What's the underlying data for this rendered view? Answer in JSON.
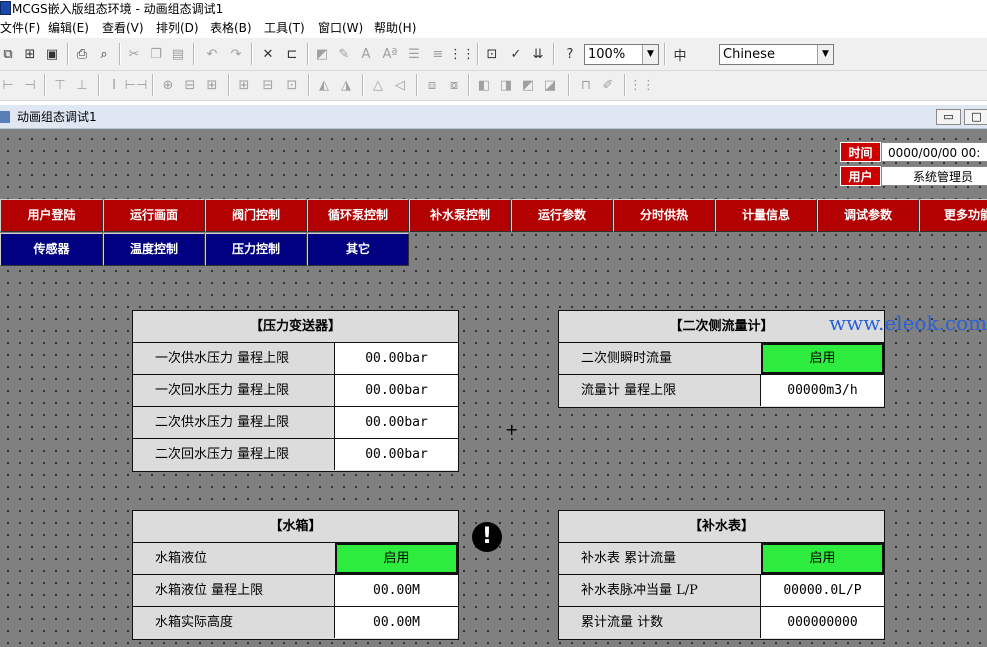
{
  "app": {
    "title": "MCGS嵌入版组态环境 - 动画组态调试1",
    "menu": [
      "文件(F)",
      "编辑(E)",
      "查看(V)",
      "排列(D)",
      "表格(B)",
      "工具(T)",
      "窗口(W)",
      "帮助(H)"
    ]
  },
  "toolbar": {
    "zoom": "100%",
    "language": "Chinese"
  },
  "window": {
    "title": "动画组态调试1",
    "minimize": "▭",
    "maximize": "□"
  },
  "info": {
    "time_label": "时间",
    "time_value": "0000/00/00 00:",
    "user_label": "用户",
    "user_value": "系统管理员"
  },
  "nav": {
    "row1": [
      "用户登陆",
      "运行画面",
      "阀门控制",
      "循环泵控制",
      "补水泵控制",
      "运行参数",
      "分时供热",
      "计量信息",
      "调试参数",
      "更多功能"
    ],
    "row2": [
      "传感器",
      "温度控制",
      "压力控制",
      "其它"
    ]
  },
  "panels": {
    "pressure": {
      "title": "【压力变送器】",
      "rows": [
        {
          "label": "一次供水压力 量程上限",
          "value": "00.00bar"
        },
        {
          "label": "一次回水压力 量程上限",
          "value": "00.00bar"
        },
        {
          "label": "二次供水压力 量程上限",
          "value": "00.00bar"
        },
        {
          "label": "二次回水压力 量程上限",
          "value": "00.00bar"
        }
      ]
    },
    "flow": {
      "title": "【二次侧流量计】",
      "rows": [
        {
          "label": "二次侧瞬时流量",
          "value": "启用"
        },
        {
          "label": "流量计 量程上限",
          "value": "00000m3/h"
        }
      ]
    },
    "tank": {
      "title": "【水箱】",
      "rows": [
        {
          "label": "水箱液位",
          "value": "启用"
        },
        {
          "label": "水箱液位 量程上限",
          "value": "00.00M"
        },
        {
          "label": "水箱实际高度",
          "value": "00.00M"
        }
      ]
    },
    "makeup": {
      "title": "【补水表】",
      "rows": [
        {
          "label": "补水表 累计流量",
          "value": "启用"
        },
        {
          "label": "补水表脉冲当量 L/P",
          "value": "00000.0L/P"
        },
        {
          "label": "累计流量 计数",
          "value": "000000000"
        }
      ]
    }
  },
  "canvas": {
    "alert_symbol": "!",
    "watermark": "www.eleok.com"
  }
}
